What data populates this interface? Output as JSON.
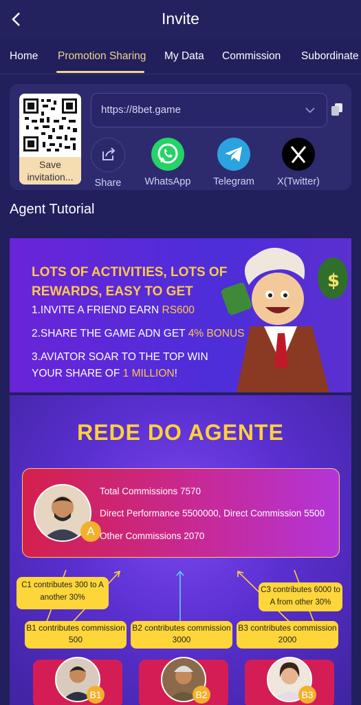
{
  "header": {
    "title": "Invite"
  },
  "tabs": [
    {
      "label": "Home"
    },
    {
      "label": "Promotion Sharing",
      "active": true
    },
    {
      "label": "My Data"
    },
    {
      "label": "Commission"
    },
    {
      "label": "Subordinate"
    }
  ],
  "share_card": {
    "save_label": "Save invitation...",
    "url": "https://8bet.game",
    "channels": [
      {
        "label": "Share",
        "icon": "share-icon"
      },
      {
        "label": "WhatsApp",
        "icon": "whatsapp-icon",
        "color": "#25d366"
      },
      {
        "label": "Telegram",
        "icon": "telegram-icon",
        "color": "#2aa3e0"
      },
      {
        "label": "X(Twitter)",
        "icon": "x-icon",
        "color": "#000000"
      }
    ]
  },
  "tutorial": {
    "heading": "Agent Tutorial",
    "banner1": {
      "headline_1": "LOTS OF ACTIVITIES, LOTS OF",
      "headline_2": "REWARDS, EASY TO GET",
      "line1": "1.INVITE A FRIEND EARN ",
      "line1_hl": "RS600",
      "line2": "2.SHARE THE GAME ADN GET ",
      "line2_hl": "4% BONUS",
      "line3": "3.AVIATOR SOAR TO THE TOP WIN",
      "line4": "YOUR SHARE OF ",
      "line4_hl": "1 MILLION",
      "line4_end": "!"
    },
    "banner2": {
      "title": "REDE DO AGENTE",
      "agent_badge": "A",
      "total": "Total Commissions 7570",
      "direct": "Direct Performance 5500000, Direct Commission 5500",
      "other": "Other Commissions 2070",
      "tip_c1": "C1 contributes 300 to A another 30%",
      "tip_c3": "C3 contributes 6000 to A from other 30%",
      "b1": "B1 contributes commission 500",
      "b2": "B2 contributes commission 3000",
      "b3": "B3 contributes commission 2000",
      "badge_b1": "B1",
      "badge_b2": "B2",
      "badge_b3": "B3"
    }
  }
}
